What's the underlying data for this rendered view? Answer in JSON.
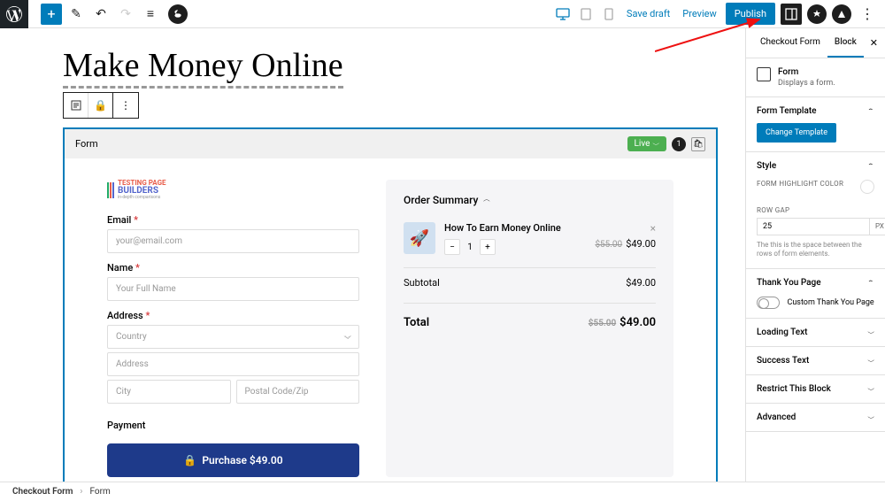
{
  "page": {
    "title": "Make Money Online"
  },
  "toolbar": {
    "save_draft": "Save draft",
    "preview": "Preview",
    "publish": "Publish"
  },
  "form_block": {
    "header_label": "Form",
    "live_label": "Live",
    "count": "1"
  },
  "form": {
    "brand_line1": "TESTING PAGE",
    "brand_line2": "BUILDERS",
    "brand_line3": "in-depth comparisons",
    "email_label": "Email",
    "email_placeholder": "your@email.com",
    "name_label": "Name",
    "name_placeholder": "Your Full Name",
    "address_label": "Address",
    "country_placeholder": "Country",
    "address_placeholder": "Address",
    "city_placeholder": "City",
    "postal_placeholder": "Postal Code/Zip",
    "payment_label": "Payment",
    "purchase_label": "Purchase $49.00"
  },
  "order": {
    "summary_label": "Order Summary",
    "item_name": "How To Earn Money Online",
    "item_old_price": "$55.00",
    "item_price": "$49.00",
    "qty": "1",
    "subtotal_label": "Subtotal",
    "subtotal_value": "$49.00",
    "total_label": "Total",
    "total_old": "$55.00",
    "total_value": "$49.00"
  },
  "sidebar": {
    "tab1": "Checkout Form",
    "tab2": "Block",
    "block_name": "Form",
    "block_desc": "Displays a form.",
    "form_template_header": "Form Template",
    "change_template_btn": "Change Template",
    "style_header": "Style",
    "highlight_color_label": "FORM HIGHLIGHT COLOR",
    "row_gap_label": "ROW GAP",
    "row_gap_value": "25",
    "row_gap_unit": "PX",
    "row_gap_help": "The this is the space between the rows of form elements.",
    "thank_you_header": "Thank You Page",
    "custom_thank_you_label": "Custom Thank You Page",
    "loading_text_header": "Loading Text",
    "success_text_header": "Success Text",
    "restrict_header": "Restrict This Block",
    "advanced_header": "Advanced"
  },
  "breadcrumb": {
    "item1": "Checkout Form",
    "item2": "Form"
  }
}
